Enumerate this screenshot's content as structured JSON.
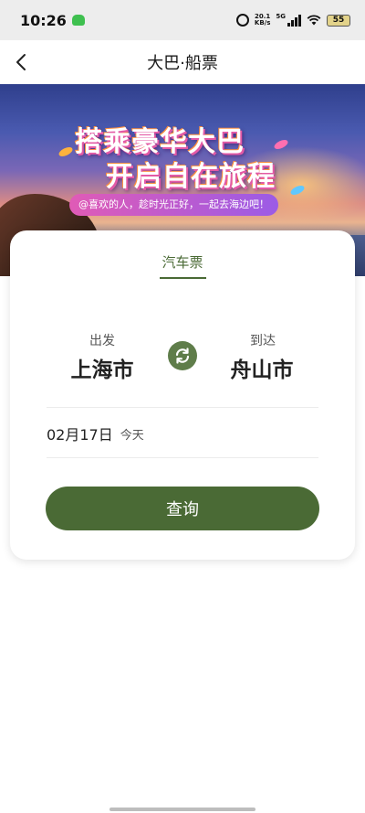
{
  "status_bar": {
    "time": "10:26",
    "net_speed_value": "20.1",
    "net_speed_unit": "KB/s",
    "network_type": "5G",
    "battery": "55"
  },
  "header": {
    "title": "大巴·船票",
    "back_icon": "chevron-left-icon"
  },
  "banner": {
    "line1": "搭乘豪华大巴",
    "line2": "开启自在旅程",
    "slogan": "@喜欢的人，趁时光正好，一起去海边吧！"
  },
  "tabs": [
    {
      "label": "汽车票",
      "active": true
    }
  ],
  "route": {
    "from_label": "出发",
    "from_city": "上海市",
    "to_label": "到达",
    "to_city": "舟山市",
    "swap_icon": "swap-icon"
  },
  "date": {
    "value": "02月17日",
    "relative": "今天"
  },
  "query_button": "查询",
  "colors": {
    "accent": "#4a6a35",
    "swap": "#5f7d4a",
    "status_bar_bg": "#ededed"
  }
}
